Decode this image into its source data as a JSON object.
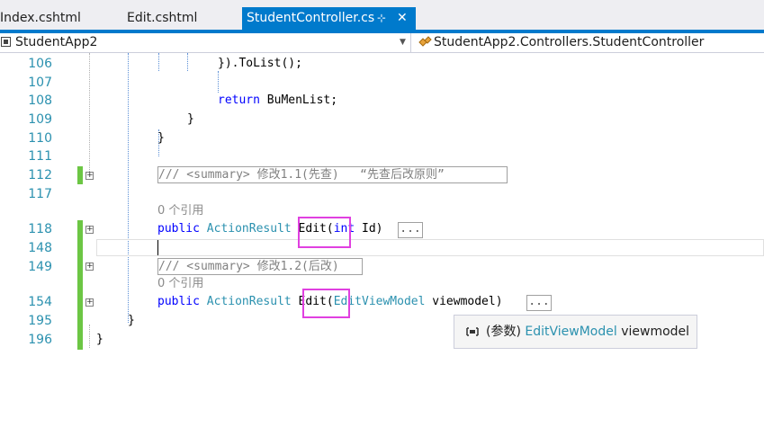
{
  "tabs": {
    "index": "Index.cshtml",
    "edit": "Edit.cshtml",
    "active": "StudentController.cs",
    "pin_glyph": "⊹",
    "close_glyph": "✕"
  },
  "navbar": {
    "project": "StudentApp2",
    "class": "StudentApp2.Controllers.StudentController"
  },
  "editor": {
    "lines": [
      {
        "num": "106"
      },
      {
        "num": "107"
      },
      {
        "num": "108"
      },
      {
        "num": "109"
      },
      {
        "num": "110"
      },
      {
        "num": "111"
      },
      {
        "num": "112"
      },
      {
        "num": "117"
      },
      {
        "num": "118"
      },
      {
        "num": "148"
      },
      {
        "num": "149"
      },
      {
        "num": "154"
      },
      {
        "num": "195"
      },
      {
        "num": "196"
      }
    ],
    "code": {
      "l106": "}).ToList();",
      "l108_kw": "return",
      "l108_rest": " BuMenList;",
      "l109": "}",
      "l110": "}",
      "l112": "/// <summary> 修改1.1(先查)   “先查后改原则”",
      "ref1": "0 个引用",
      "l118_public": "public",
      "l118_type": "ActionResult",
      "l118_method": "Edit(",
      "l118_int": "int",
      "l118_rest": " Id)",
      "collapsed": "...",
      "l149": "/// <summary> 修改1.2(后改)",
      "ref2": "0 个引用",
      "l154_public": "public",
      "l154_type": "ActionResult",
      "l154_method": "Edit(",
      "l154_ptype": "EditViewModel",
      "l154_rest": " viewmodel)",
      "l195": "}",
      "l196": "}"
    }
  },
  "tooltip": {
    "prefix": "(参数)",
    "type": "EditViewModel",
    "name": "viewmodel"
  },
  "colors": {
    "accent": "#007acc",
    "keyword": "#0000ff",
    "type": "#2b91af",
    "highlight": "#e040e0",
    "changebar": "#6cc644"
  }
}
